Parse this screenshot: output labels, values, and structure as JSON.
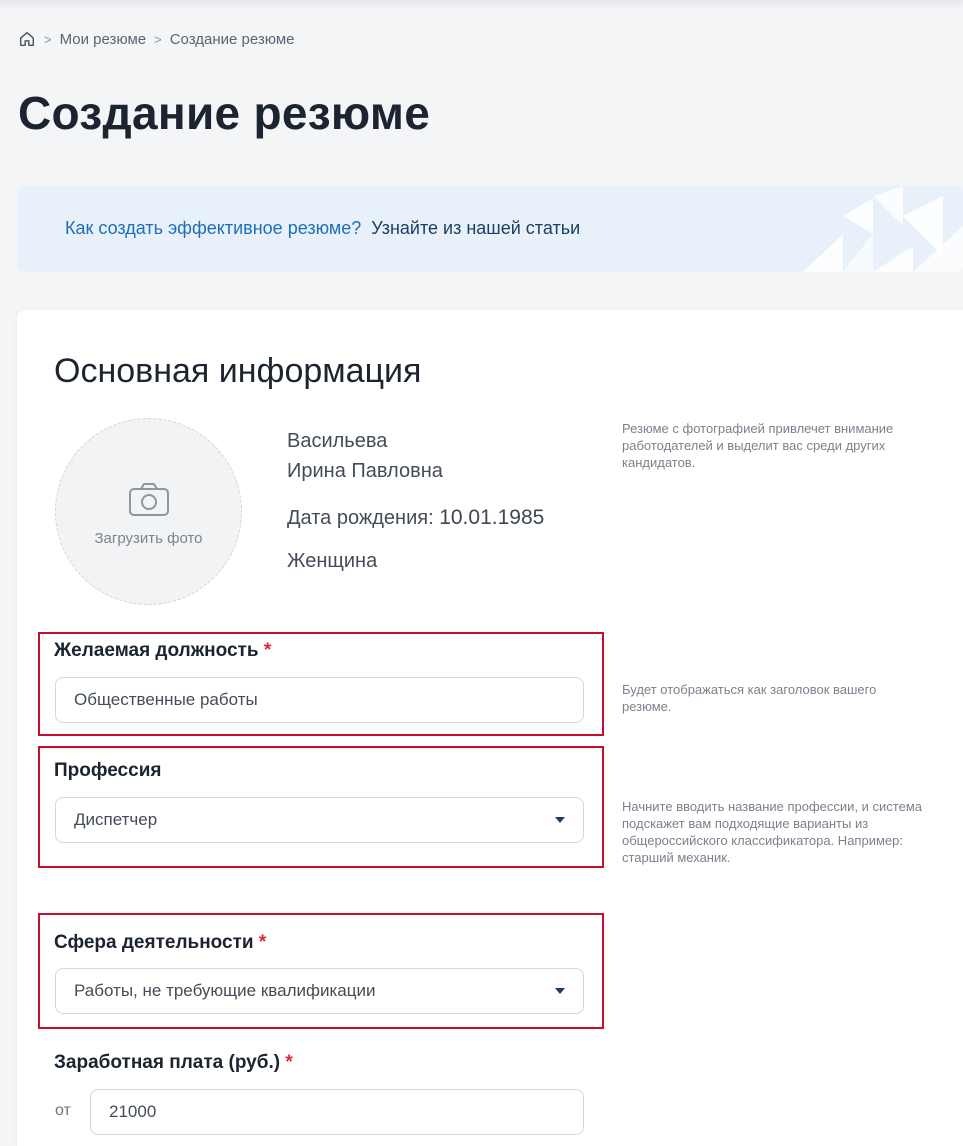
{
  "breadcrumb": {
    "home_icon": "home-icon",
    "items": [
      "Мои резюме",
      "Создание резюме"
    ],
    "separator": ">"
  },
  "page_title": "Создание резюме",
  "banner": {
    "link_text": "Как создать эффективное резюме?",
    "text": "Узнайте из нашей статьи"
  },
  "section": {
    "title": "Основная информация"
  },
  "photo": {
    "icon": "camera-icon",
    "label": "Загрузить фото"
  },
  "person": {
    "last_name": "Васильева",
    "first_middle": "Ирина Павловна",
    "birth_label": "Дата рождения:",
    "birth_value": "10.01.1985",
    "gender": "Женщина"
  },
  "hints": {
    "photo": "Резюме с фотографией привлечет внимание работодателей и выделит вас среди других кандидатов.",
    "position": "Будет отображаться как заголовок вашего резюме.",
    "profession": "Начните вводить название профессии, и система подскажет вам подходящие варианты из общероссийского классификатора. Например: старший механик."
  },
  "fields": {
    "position": {
      "label": "Желаемая должность",
      "required_mark": "*",
      "value": "Общественные работы"
    },
    "profession": {
      "label": "Профессия",
      "value": "Диспетчер"
    },
    "sphere": {
      "label": "Сфера деятельности",
      "required_mark": "*",
      "value": "Работы, не требующие квалификации"
    },
    "salary": {
      "label": "Заработная плата (руб.)",
      "required_mark": "*",
      "prefix": "от",
      "value": "21000"
    }
  },
  "colors": {
    "accent": "#1d6fb8",
    "highlight_border": "#c8102e",
    "required": "#e0263a"
  }
}
